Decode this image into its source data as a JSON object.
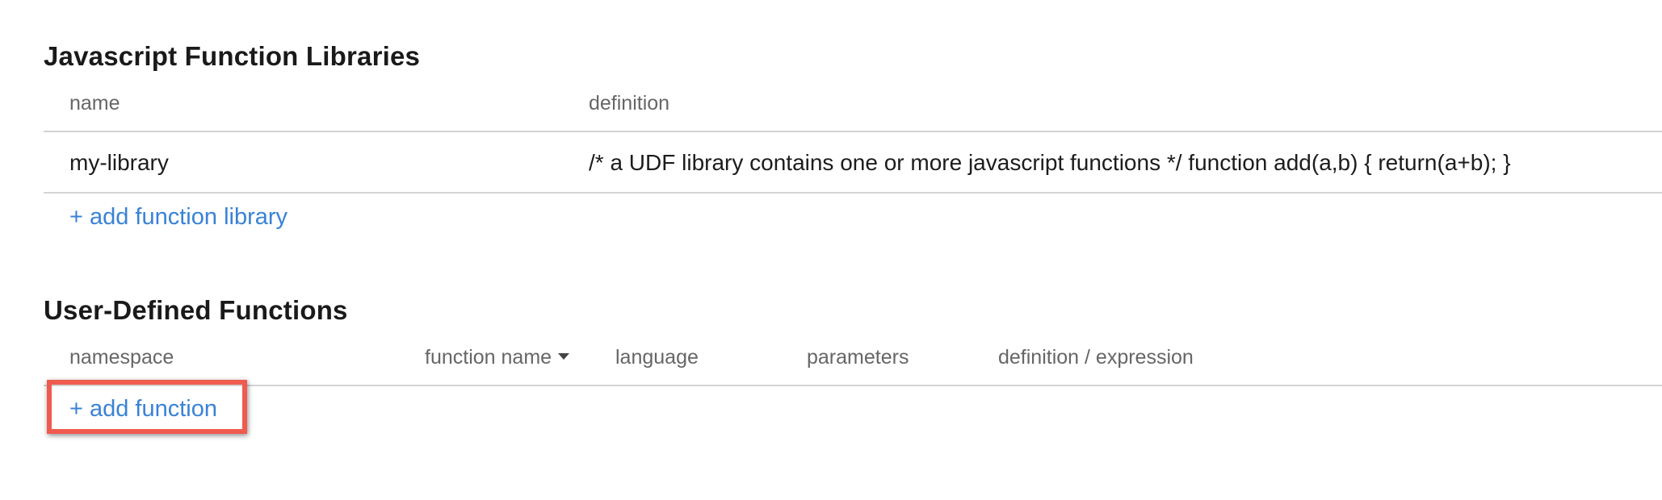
{
  "libraries": {
    "title": "Javascript Function Libraries",
    "columns": {
      "name": "name",
      "definition": "definition"
    },
    "rows": [
      {
        "name": "my-library",
        "definition": "/* a UDF library contains one or more javascript functions */ function add(a,b) { return(a+b); }"
      }
    ],
    "add_label": "+ add function library"
  },
  "udfs": {
    "title": "User-Defined Functions",
    "columns": {
      "namespace": "namespace",
      "function_name": "function name",
      "language": "language",
      "parameters": "parameters",
      "definition": "definition / expression"
    },
    "sort_column": "function_name",
    "sort_direction": "descending",
    "add_label": "+ add function"
  },
  "colors": {
    "link": "#3a82d6",
    "highlight": "#ef5b4f"
  }
}
